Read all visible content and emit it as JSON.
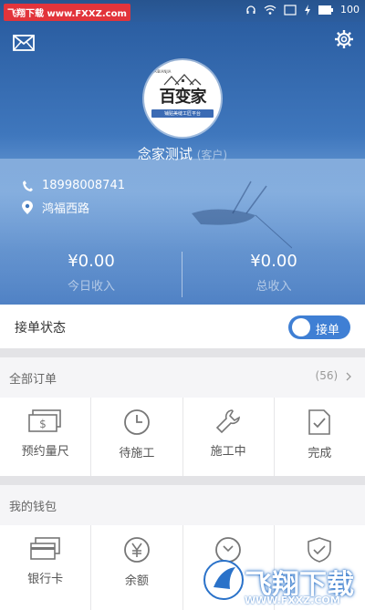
{
  "status_bar": {
    "watermark": "飞翔下载 www.FXXZ.com",
    "battery": "100"
  },
  "header": {
    "mail_icon": "mail-icon",
    "settings_icon": "gear-icon"
  },
  "profile": {
    "logo": {
      "brand": "百变家",
      "english": "BAIBIANJIA",
      "tagline": "铺贴美缝工匠平台"
    },
    "name": "念家测试",
    "name_suffix": "(客户)",
    "phone": "18998008741",
    "address": "鸿福西路"
  },
  "stats": {
    "today_amount": "¥0.00",
    "today_label": "今日收入",
    "total_amount": "¥0.00",
    "total_label": "总收入"
  },
  "order_status": {
    "label": "接单状态",
    "toggle_text": "接单"
  },
  "orders": {
    "title": "全部订单",
    "count": "(56)",
    "items": [
      {
        "label": "预约量尺",
        "icon": "banknote-icon"
      },
      {
        "label": "待施工",
        "icon": "clock-icon"
      },
      {
        "label": "施工中",
        "icon": "wrench-icon"
      },
      {
        "label": "完成",
        "icon": "document-check-icon"
      }
    ]
  },
  "wallet": {
    "title": "我的钱包",
    "items": [
      {
        "label": "银行卡",
        "icon": "bank-card-icon"
      },
      {
        "label": "余额",
        "icon": "yen-icon"
      },
      {
        "label": "",
        "icon": "coin-icon"
      },
      {
        "label": "",
        "icon": "shield-icon"
      }
    ]
  },
  "watermark": {
    "brand": "飞翔下载",
    "url": "WWW.FXXZ.COM"
  },
  "colors": {
    "accent": "#3f7fd4",
    "hero": "#3f77bd"
  }
}
